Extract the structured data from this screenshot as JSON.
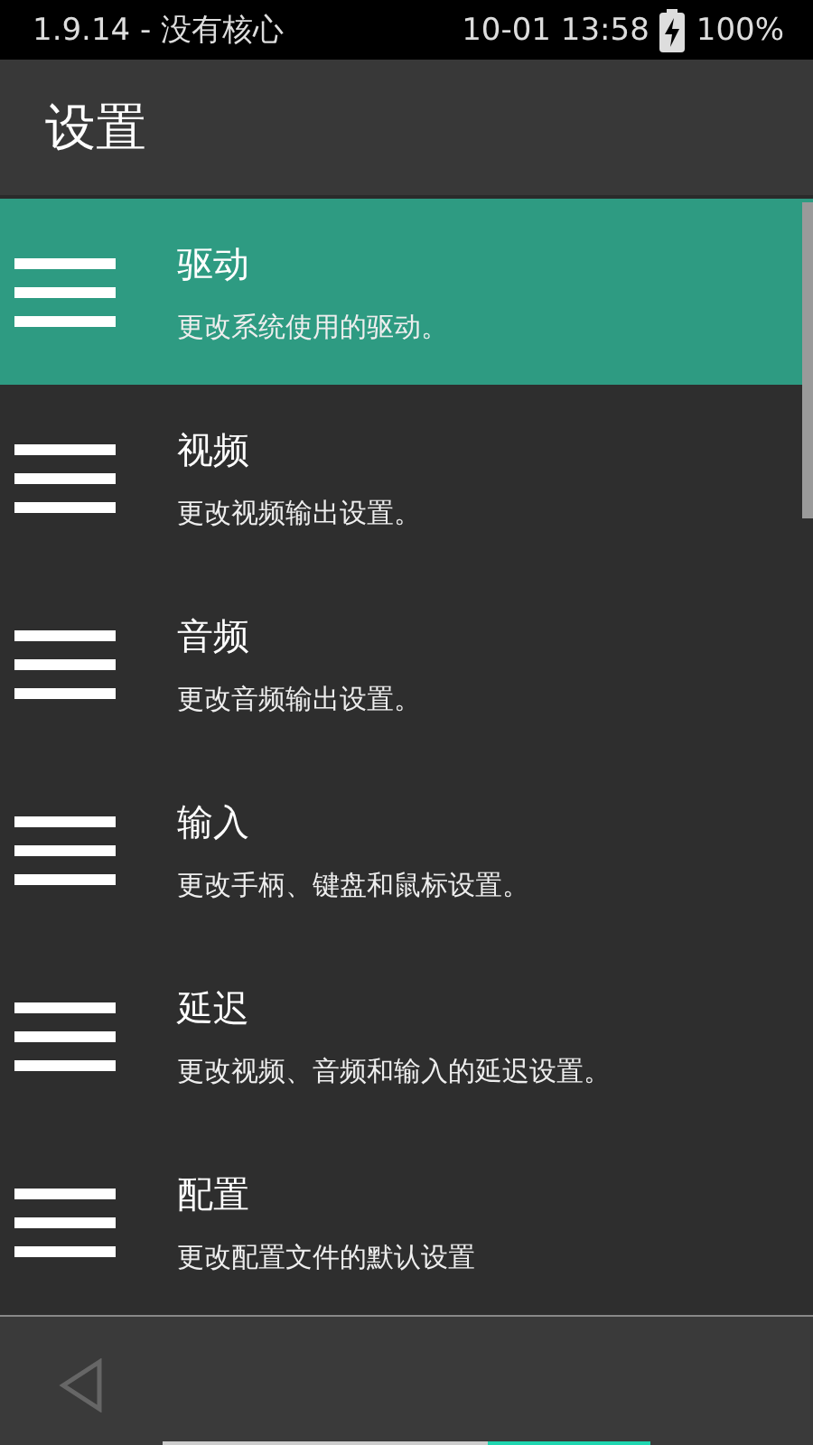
{
  "status_bar": {
    "left": "1.9.14 - 没有核心",
    "time": "10-01 13:58",
    "battery": "100%"
  },
  "toolbar": {
    "title": "设置"
  },
  "items": [
    {
      "title": "驱动",
      "subtitle": "更改系统使用的驱动。",
      "selected": true
    },
    {
      "title": "视频",
      "subtitle": "更改视频输出设置。",
      "selected": false
    },
    {
      "title": "音频",
      "subtitle": "更改音频输出设置。",
      "selected": false
    },
    {
      "title": "输入",
      "subtitle": "更改手柄、键盘和鼠标设置。",
      "selected": false
    },
    {
      "title": "延迟",
      "subtitle": "更改视频、音频和输入的延迟设置。",
      "selected": false
    },
    {
      "title": "配置",
      "subtitle": "更改配置文件的默认设置",
      "selected": false
    }
  ]
}
